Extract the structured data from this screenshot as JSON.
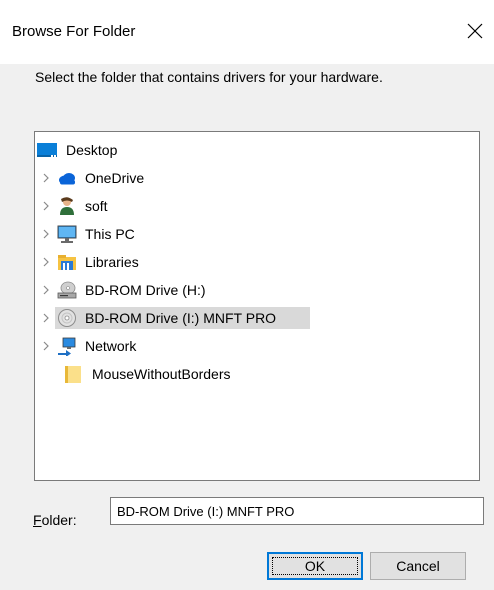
{
  "window": {
    "title": "Browse For Folder",
    "close_glyph": "✕"
  },
  "instruction": "Select the folder that contains drivers for your hardware.",
  "tree": {
    "items": [
      {
        "label": "Desktop",
        "icon": "desktop-icon",
        "expandable": false,
        "selected": false
      },
      {
        "label": "OneDrive",
        "icon": "cloud-icon",
        "expandable": true,
        "selected": false
      },
      {
        "label": "soft",
        "icon": "user-icon",
        "expandable": true,
        "selected": false
      },
      {
        "label": "This PC",
        "icon": "computer-icon",
        "expandable": true,
        "selected": false
      },
      {
        "label": "Libraries",
        "icon": "libraries-icon",
        "expandable": true,
        "selected": false
      },
      {
        "label": "BD-ROM Drive (H:)",
        "icon": "optical-drive-icon",
        "expandable": true,
        "selected": false
      },
      {
        "label": "BD-ROM Drive (I:) MNFT PRO",
        "icon": "disc-icon",
        "expandable": true,
        "selected": true
      },
      {
        "label": "Network",
        "icon": "network-icon",
        "expandable": true,
        "selected": false
      },
      {
        "label": "MouseWithoutBorders",
        "icon": "folder-icon",
        "expandable": false,
        "selected": false
      }
    ]
  },
  "folder": {
    "label_accel": "F",
    "label_rest": "older:",
    "value": "BD-ROM Drive (I:) MNFT PRO"
  },
  "buttons": {
    "ok": "OK",
    "cancel": "Cancel"
  },
  "colors": {
    "dialog_bg": "#f0f0f0",
    "accent": "#0078d7",
    "selection": "#d9d9d9"
  }
}
